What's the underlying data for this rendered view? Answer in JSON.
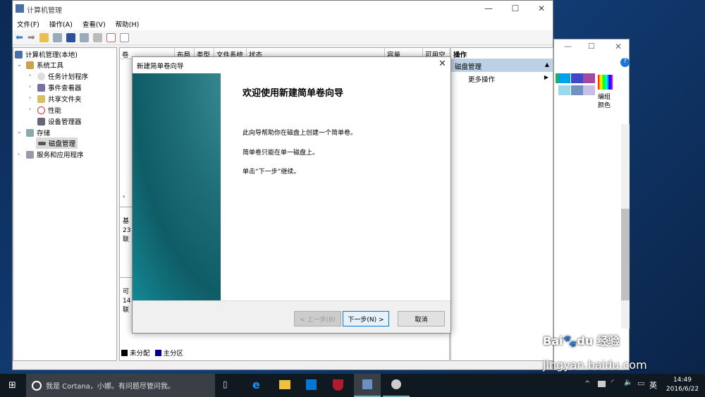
{
  "main_window": {
    "title": "计算机管理",
    "menu": [
      "文件(F)",
      "操作(A)",
      "查看(V)",
      "帮助(H)"
    ],
    "tree": [
      {
        "label": "计算机管理(本地)",
        "icon": "computer-management-icon"
      },
      {
        "label": "系统工具",
        "icon": "tools-icon",
        "expanded": true
      },
      {
        "label": "任务计划程序",
        "icon": "clock-icon"
      },
      {
        "label": "事件查看器",
        "icon": "event-viewer-icon"
      },
      {
        "label": "共享文件夹",
        "icon": "shared-folder-icon"
      },
      {
        "label": "性能",
        "icon": "performance-icon"
      },
      {
        "label": "设备管理器",
        "icon": "device-manager-icon"
      },
      {
        "label": "存储",
        "icon": "storage-icon",
        "expanded": true
      },
      {
        "label": "磁盘管理",
        "icon": "disk-icon",
        "selected": true
      },
      {
        "label": "服务和应用程序",
        "icon": "services-icon"
      }
    ],
    "columns": [
      "卷",
      "布局",
      "类型",
      "文件系统",
      "状态",
      "容量",
      "可用空"
    ],
    "disk_rows": [
      {
        "l1": "基",
        "l2": "23",
        "l3": "联"
      },
      {
        "l1": "可",
        "l2": "14",
        "l3": "联"
      }
    ],
    "legend": [
      {
        "label": "未分配",
        "color": "#000000"
      },
      {
        "label": "主分区",
        "color": "#00008b"
      }
    ],
    "actions": {
      "header": "操作",
      "section": "磁盘管理",
      "more": "更多操作"
    }
  },
  "wizard": {
    "title": "新建简单卷向导",
    "heading": "欢迎使用新建简单卷向导",
    "lines": [
      "此向导帮助你在磁盘上创建一个简单卷。",
      "简单卷只能在单一磁盘上。",
      "单击“下一步”继续。"
    ],
    "back": "< 上一步(B)",
    "next": "下一步(N) >",
    "cancel": "取消"
  },
  "paint": {
    "edit_colors": "编组\n颜色"
  },
  "taskbar": {
    "search": "我是 Cortana，小娜。有问题尽管问我。",
    "time": "14:49",
    "date": "2016/6/22",
    "ime": "英"
  },
  "watermark": "Baidu经验 jingyan.baidu.com"
}
